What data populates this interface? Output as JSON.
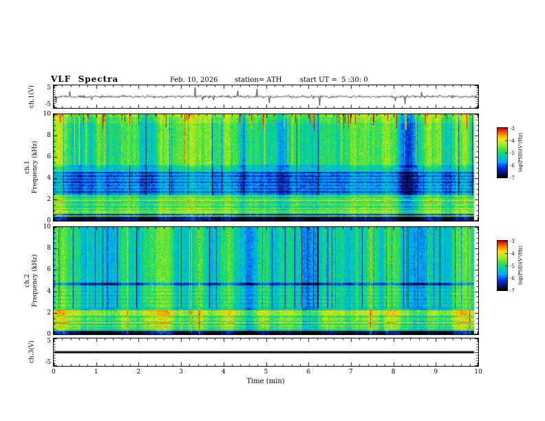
{
  "header": {
    "title": "VLF  Spectra",
    "date": "Feb. 10, 2026",
    "station": "station= ATH",
    "start_ut": "start UT =  5 :30: 0"
  },
  "panels": {
    "wave1": {
      "label": "ch.1(V)",
      "yticks": [
        "5",
        "-5"
      ]
    },
    "spec1": {
      "label_line1": "ch.1",
      "label_line2": "Frequency  (kHz)",
      "yticks": [
        "0",
        "2",
        "4",
        "6",
        "8",
        "10"
      ]
    },
    "spec2": {
      "label_line1": "ch.2",
      "label_line2": "Frequency  (kHz)",
      "yticks": [
        "0",
        "2",
        "4",
        "6",
        "8",
        "10"
      ]
    },
    "wave3": {
      "label": "ch.3(V)",
      "yticks": [
        "5",
        "-5"
      ]
    }
  },
  "xaxis": {
    "label": "Time  (min)",
    "ticks": [
      "0",
      "1",
      "2",
      "3",
      "4",
      "5",
      "6",
      "7",
      "8",
      "9",
      "10"
    ]
  },
  "colorbars": [
    {
      "label": "log(PSD)(V²/Hz)",
      "ticks": [
        "-3",
        "-4",
        "-5",
        "-6",
        "-7"
      ]
    },
    {
      "label": "log(PSD)(V²/Hz)",
      "ticks": [
        "-3",
        "-4",
        "-5",
        "-6",
        "-7"
      ]
    }
  ],
  "chart_data": [
    {
      "type": "line",
      "name": "ch.1(V) waveform",
      "xlabel": "Time (min)",
      "xlim": [
        0,
        10
      ],
      "ylabel": "ch.1(V)",
      "ylim": [
        -5,
        5
      ],
      "yticks": [
        -5,
        5
      ],
      "description": "Broadband noise trace centered on 0 V, amplitude roughly ±0.5 V, with frequent impulsive sferic spikes reaching about ±4 V across the full 10 minutes."
    },
    {
      "type": "heatmap",
      "name": "ch.1 spectrogram",
      "xlabel": "Time (min)",
      "xlim": [
        0,
        10
      ],
      "ylabel": "Frequency (kHz)",
      "ylim": [
        0,
        10
      ],
      "zlabel": "log(PSD)(V²/Hz)",
      "zlim": [
        -7,
        -3
      ],
      "palette": "jet-with-black-floor",
      "legend_position": "right-colorbar",
      "features": [
        "mottled green/cyan background (~-5) with strong vertical striping",
        "red/orange impulsive streaks near 8.5-10 kHz (~-3)",
        "dark blue band ~2.5-4.5 kHz (~-6) crossed by darker horizontal harmonic lines",
        "bright green/yellow horizontal striations below ~2.5 kHz",
        "black band below ~0.3 kHz (~-7)"
      ]
    },
    {
      "type": "heatmap",
      "name": "ch.2 spectrogram",
      "xlabel": "Time (min)",
      "xlim": [
        0,
        10
      ],
      "ylabel": "Frequency (kHz)",
      "ylim": [
        0,
        10
      ],
      "zlabel": "log(PSD)(V²/Hz)",
      "zlim": [
        -7,
        -3
      ],
      "palette": "jet-with-black-floor",
      "legend_position": "right-colorbar",
      "features": [
        "cyan-green background (~-5) with frequent dark blue vertical dropout streaks above ~2.5 kHz",
        "occasional bright yellow/orange full-height columns",
        "yellow/orange horizontal band ~1.7-2.2 kHz (~-4)",
        "dark horizontal line near 4.7 kHz",
        "yellow striations below ~1.7 kHz, black band below ~0.3 kHz (~-7)"
      ]
    },
    {
      "type": "line",
      "name": "ch.3(V) waveform",
      "xlabel": "Time (min)",
      "xlim": [
        0,
        10
      ],
      "ylabel": "ch.3(V)",
      "ylim": [
        -5,
        5
      ],
      "yticks": [
        -5,
        5
      ],
      "description": "Constant flat thick line at 0 V (no signal) across the full record."
    }
  ]
}
